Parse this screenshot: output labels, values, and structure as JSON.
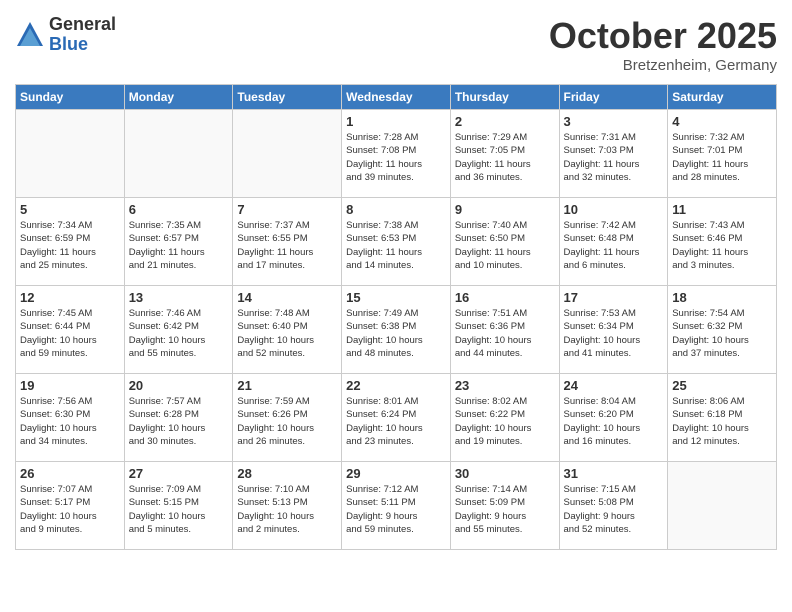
{
  "logo": {
    "general": "General",
    "blue": "Blue"
  },
  "title": "October 2025",
  "location": "Bretzenheim, Germany",
  "days_of_week": [
    "Sunday",
    "Monday",
    "Tuesday",
    "Wednesday",
    "Thursday",
    "Friday",
    "Saturday"
  ],
  "weeks": [
    [
      {
        "day": "",
        "info": ""
      },
      {
        "day": "",
        "info": ""
      },
      {
        "day": "",
        "info": ""
      },
      {
        "day": "1",
        "info": "Sunrise: 7:28 AM\nSunset: 7:08 PM\nDaylight: 11 hours\nand 39 minutes."
      },
      {
        "day": "2",
        "info": "Sunrise: 7:29 AM\nSunset: 7:05 PM\nDaylight: 11 hours\nand 36 minutes."
      },
      {
        "day": "3",
        "info": "Sunrise: 7:31 AM\nSunset: 7:03 PM\nDaylight: 11 hours\nand 32 minutes."
      },
      {
        "day": "4",
        "info": "Sunrise: 7:32 AM\nSunset: 7:01 PM\nDaylight: 11 hours\nand 28 minutes."
      }
    ],
    [
      {
        "day": "5",
        "info": "Sunrise: 7:34 AM\nSunset: 6:59 PM\nDaylight: 11 hours\nand 25 minutes."
      },
      {
        "day": "6",
        "info": "Sunrise: 7:35 AM\nSunset: 6:57 PM\nDaylight: 11 hours\nand 21 minutes."
      },
      {
        "day": "7",
        "info": "Sunrise: 7:37 AM\nSunset: 6:55 PM\nDaylight: 11 hours\nand 17 minutes."
      },
      {
        "day": "8",
        "info": "Sunrise: 7:38 AM\nSunset: 6:53 PM\nDaylight: 11 hours\nand 14 minutes."
      },
      {
        "day": "9",
        "info": "Sunrise: 7:40 AM\nSunset: 6:50 PM\nDaylight: 11 hours\nand 10 minutes."
      },
      {
        "day": "10",
        "info": "Sunrise: 7:42 AM\nSunset: 6:48 PM\nDaylight: 11 hours\nand 6 minutes."
      },
      {
        "day": "11",
        "info": "Sunrise: 7:43 AM\nSunset: 6:46 PM\nDaylight: 11 hours\nand 3 minutes."
      }
    ],
    [
      {
        "day": "12",
        "info": "Sunrise: 7:45 AM\nSunset: 6:44 PM\nDaylight: 10 hours\nand 59 minutes."
      },
      {
        "day": "13",
        "info": "Sunrise: 7:46 AM\nSunset: 6:42 PM\nDaylight: 10 hours\nand 55 minutes."
      },
      {
        "day": "14",
        "info": "Sunrise: 7:48 AM\nSunset: 6:40 PM\nDaylight: 10 hours\nand 52 minutes."
      },
      {
        "day": "15",
        "info": "Sunrise: 7:49 AM\nSunset: 6:38 PM\nDaylight: 10 hours\nand 48 minutes."
      },
      {
        "day": "16",
        "info": "Sunrise: 7:51 AM\nSunset: 6:36 PM\nDaylight: 10 hours\nand 44 minutes."
      },
      {
        "day": "17",
        "info": "Sunrise: 7:53 AM\nSunset: 6:34 PM\nDaylight: 10 hours\nand 41 minutes."
      },
      {
        "day": "18",
        "info": "Sunrise: 7:54 AM\nSunset: 6:32 PM\nDaylight: 10 hours\nand 37 minutes."
      }
    ],
    [
      {
        "day": "19",
        "info": "Sunrise: 7:56 AM\nSunset: 6:30 PM\nDaylight: 10 hours\nand 34 minutes."
      },
      {
        "day": "20",
        "info": "Sunrise: 7:57 AM\nSunset: 6:28 PM\nDaylight: 10 hours\nand 30 minutes."
      },
      {
        "day": "21",
        "info": "Sunrise: 7:59 AM\nSunset: 6:26 PM\nDaylight: 10 hours\nand 26 minutes."
      },
      {
        "day": "22",
        "info": "Sunrise: 8:01 AM\nSunset: 6:24 PM\nDaylight: 10 hours\nand 23 minutes."
      },
      {
        "day": "23",
        "info": "Sunrise: 8:02 AM\nSunset: 6:22 PM\nDaylight: 10 hours\nand 19 minutes."
      },
      {
        "day": "24",
        "info": "Sunrise: 8:04 AM\nSunset: 6:20 PM\nDaylight: 10 hours\nand 16 minutes."
      },
      {
        "day": "25",
        "info": "Sunrise: 8:06 AM\nSunset: 6:18 PM\nDaylight: 10 hours\nand 12 minutes."
      }
    ],
    [
      {
        "day": "26",
        "info": "Sunrise: 7:07 AM\nSunset: 5:17 PM\nDaylight: 10 hours\nand 9 minutes."
      },
      {
        "day": "27",
        "info": "Sunrise: 7:09 AM\nSunset: 5:15 PM\nDaylight: 10 hours\nand 5 minutes."
      },
      {
        "day": "28",
        "info": "Sunrise: 7:10 AM\nSunset: 5:13 PM\nDaylight: 10 hours\nand 2 minutes."
      },
      {
        "day": "29",
        "info": "Sunrise: 7:12 AM\nSunset: 5:11 PM\nDaylight: 9 hours\nand 59 minutes."
      },
      {
        "day": "30",
        "info": "Sunrise: 7:14 AM\nSunset: 5:09 PM\nDaylight: 9 hours\nand 55 minutes."
      },
      {
        "day": "31",
        "info": "Sunrise: 7:15 AM\nSunset: 5:08 PM\nDaylight: 9 hours\nand 52 minutes."
      },
      {
        "day": "",
        "info": ""
      }
    ]
  ]
}
